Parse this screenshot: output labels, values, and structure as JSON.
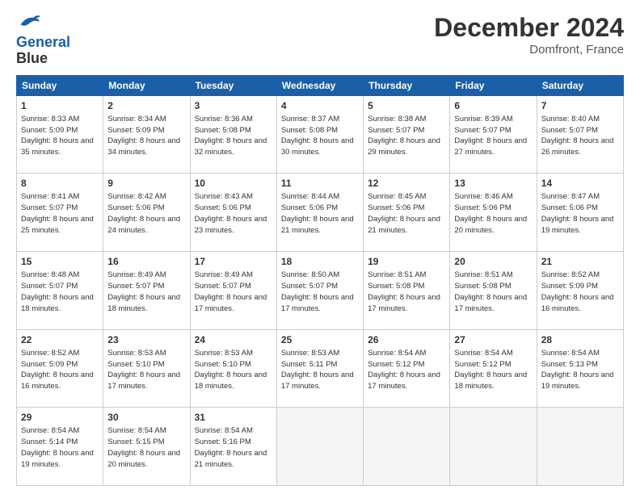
{
  "header": {
    "logo_line1": "General",
    "logo_line2": "Blue",
    "month": "December 2024",
    "location": "Domfront, France"
  },
  "weekdays": [
    "Sunday",
    "Monday",
    "Tuesday",
    "Wednesday",
    "Thursday",
    "Friday",
    "Saturday"
  ],
  "weeks": [
    [
      {
        "day": 1,
        "sunrise": "8:33 AM",
        "sunset": "5:09 PM",
        "daylight": "8 hours and 35 minutes."
      },
      {
        "day": 2,
        "sunrise": "8:34 AM",
        "sunset": "5:09 PM",
        "daylight": "8 hours and 34 minutes."
      },
      {
        "day": 3,
        "sunrise": "8:36 AM",
        "sunset": "5:08 PM",
        "daylight": "8 hours and 32 minutes."
      },
      {
        "day": 4,
        "sunrise": "8:37 AM",
        "sunset": "5:08 PM",
        "daylight": "8 hours and 30 minutes."
      },
      {
        "day": 5,
        "sunrise": "8:38 AM",
        "sunset": "5:07 PM",
        "daylight": "8 hours and 29 minutes."
      },
      {
        "day": 6,
        "sunrise": "8:39 AM",
        "sunset": "5:07 PM",
        "daylight": "8 hours and 27 minutes."
      },
      {
        "day": 7,
        "sunrise": "8:40 AM",
        "sunset": "5:07 PM",
        "daylight": "8 hours and 26 minutes."
      }
    ],
    [
      {
        "day": 8,
        "sunrise": "8:41 AM",
        "sunset": "5:07 PM",
        "daylight": "8 hours and 25 minutes."
      },
      {
        "day": 9,
        "sunrise": "8:42 AM",
        "sunset": "5:06 PM",
        "daylight": "8 hours and 24 minutes."
      },
      {
        "day": 10,
        "sunrise": "8:43 AM",
        "sunset": "5:06 PM",
        "daylight": "8 hours and 23 minutes."
      },
      {
        "day": 11,
        "sunrise": "8:44 AM",
        "sunset": "5:06 PM",
        "daylight": "8 hours and 21 minutes."
      },
      {
        "day": 12,
        "sunrise": "8:45 AM",
        "sunset": "5:06 PM",
        "daylight": "8 hours and 21 minutes."
      },
      {
        "day": 13,
        "sunrise": "8:46 AM",
        "sunset": "5:06 PM",
        "daylight": "8 hours and 20 minutes."
      },
      {
        "day": 14,
        "sunrise": "8:47 AM",
        "sunset": "5:06 PM",
        "daylight": "8 hours and 19 minutes."
      }
    ],
    [
      {
        "day": 15,
        "sunrise": "8:48 AM",
        "sunset": "5:07 PM",
        "daylight": "8 hours and 18 minutes."
      },
      {
        "day": 16,
        "sunrise": "8:49 AM",
        "sunset": "5:07 PM",
        "daylight": "8 hours and 18 minutes."
      },
      {
        "day": 17,
        "sunrise": "8:49 AM",
        "sunset": "5:07 PM",
        "daylight": "8 hours and 17 minutes."
      },
      {
        "day": 18,
        "sunrise": "8:50 AM",
        "sunset": "5:07 PM",
        "daylight": "8 hours and 17 minutes."
      },
      {
        "day": 19,
        "sunrise": "8:51 AM",
        "sunset": "5:08 PM",
        "daylight": "8 hours and 17 minutes."
      },
      {
        "day": 20,
        "sunrise": "8:51 AM",
        "sunset": "5:08 PM",
        "daylight": "8 hours and 17 minutes."
      },
      {
        "day": 21,
        "sunrise": "8:52 AM",
        "sunset": "5:09 PM",
        "daylight": "8 hours and 16 minutes."
      }
    ],
    [
      {
        "day": 22,
        "sunrise": "8:52 AM",
        "sunset": "5:09 PM",
        "daylight": "8 hours and 16 minutes."
      },
      {
        "day": 23,
        "sunrise": "8:53 AM",
        "sunset": "5:10 PM",
        "daylight": "8 hours and 17 minutes."
      },
      {
        "day": 24,
        "sunrise": "8:53 AM",
        "sunset": "5:10 PM",
        "daylight": "8 hours and 18 minutes."
      },
      {
        "day": 25,
        "sunrise": "8:53 AM",
        "sunset": "5:11 PM",
        "daylight": "8 hours and 17 minutes."
      },
      {
        "day": 26,
        "sunrise": "8:54 AM",
        "sunset": "5:12 PM",
        "daylight": "8 hours and 17 minutes."
      },
      {
        "day": 27,
        "sunrise": "8:54 AM",
        "sunset": "5:12 PM",
        "daylight": "8 hours and 18 minutes."
      },
      {
        "day": 28,
        "sunrise": "8:54 AM",
        "sunset": "5:13 PM",
        "daylight": "8 hours and 19 minutes."
      }
    ],
    [
      {
        "day": 29,
        "sunrise": "8:54 AM",
        "sunset": "5:14 PM",
        "daylight": "8 hours and 19 minutes."
      },
      {
        "day": 30,
        "sunrise": "8:54 AM",
        "sunset": "5:15 PM",
        "daylight": "8 hours and 20 minutes."
      },
      {
        "day": 31,
        "sunrise": "8:54 AM",
        "sunset": "5:16 PM",
        "daylight": "8 hours and 21 minutes."
      },
      null,
      null,
      null,
      null
    ]
  ]
}
